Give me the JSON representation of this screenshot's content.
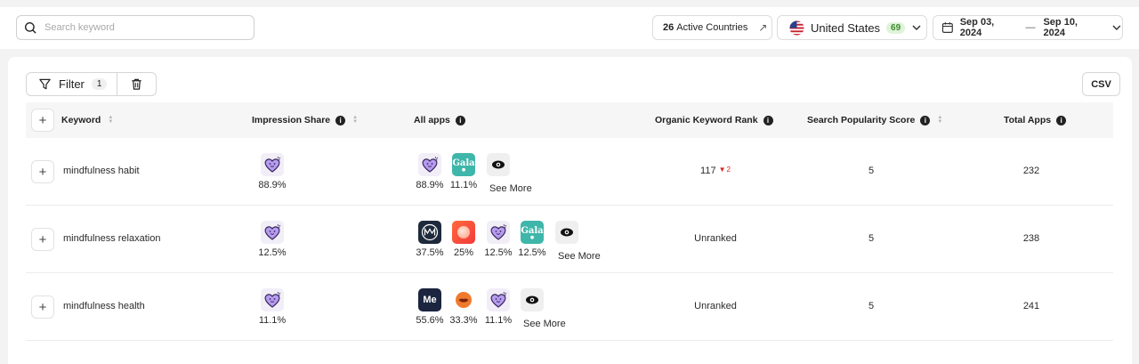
{
  "search": {
    "placeholder": "Search keyword"
  },
  "header": {
    "active_countries_count": "26",
    "active_countries_label": "Active Countries",
    "country": "United States",
    "country_badge": "69",
    "date_start": "Sep 03, 2024",
    "date_dash": "—",
    "date_end": "Sep 10, 2024"
  },
  "toolbar": {
    "filter_label": "Filter",
    "filter_count": "1",
    "csv_label": "CSV"
  },
  "table": {
    "columns": {
      "keyword": "Keyword",
      "impression_share": "Impression Share",
      "all_apps": "All apps",
      "organic_rank": "Organic Keyword Rank",
      "popularity": "Search Popularity Score",
      "total_apps": "Total Apps"
    },
    "see_more": "See More",
    "rows": [
      {
        "keyword": "mindfulness habit",
        "impression_share": "88.9%",
        "apps": [
          {
            "icon": "heart-app-icon",
            "pct": "88.9%"
          },
          {
            "icon": "gala-app-icon",
            "pct": "11.1%"
          }
        ],
        "rank": "117",
        "rank_change": "2",
        "popularity": "5",
        "total_apps": "232"
      },
      {
        "keyword": "mindfulness relaxation",
        "impression_share": "12.5%",
        "apps": [
          {
            "icon": "mm-app-icon",
            "pct": "37.5%"
          },
          {
            "icon": "orange-app-icon",
            "pct": "25%"
          },
          {
            "icon": "heart-app-icon",
            "pct": "12.5%"
          },
          {
            "icon": "gala-app-icon",
            "pct": "12.5%"
          }
        ],
        "rank": "Unranked",
        "popularity": "5",
        "total_apps": "238"
      },
      {
        "keyword": "mindfulness health",
        "impression_share": "11.1%",
        "apps": [
          {
            "icon": "me-app-icon",
            "pct": "55.6%"
          },
          {
            "icon": "lips-app-icon",
            "pct": "33.3%"
          },
          {
            "icon": "heart-app-icon",
            "pct": "11.1%"
          }
        ],
        "rank": "Unranked",
        "popularity": "5",
        "total_apps": "241"
      }
    ]
  },
  "colors": {
    "badge_green": "#3b8a2e",
    "rank_down": "#dd2222",
    "heart_purple": "#b79cf0"
  }
}
